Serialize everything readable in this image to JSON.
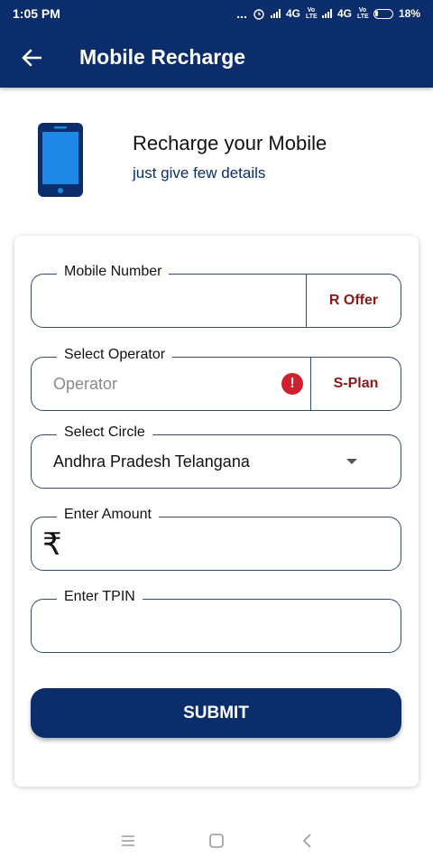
{
  "status_bar": {
    "time": "1:05 PM",
    "dots": "...",
    "network_1": "4G",
    "network_2": "4G",
    "volte_label": "Vo LTE",
    "battery": "18%"
  },
  "app_bar": {
    "title": "Mobile Recharge",
    "back_icon": "back-arrow-icon"
  },
  "header": {
    "title": "Recharge your Mobile",
    "subtitle": "just give few details",
    "icon": "mobile-phone-icon"
  },
  "form": {
    "mobile": {
      "label": "Mobile Number",
      "value": "",
      "action": "R Offer"
    },
    "operator": {
      "label": "Select Operator",
      "placeholder": "Operator",
      "action": "S-Plan",
      "error_icon": "alert-icon"
    },
    "circle": {
      "label": "Select Circle",
      "value": "Andhra Pradesh Telangana",
      "dropdown_icon": "caret-down-icon"
    },
    "amount": {
      "label": "Enter Amount",
      "currency_symbol": "₹",
      "value": ""
    },
    "tpin": {
      "label": "Enter TPIN",
      "value": ""
    },
    "submit_label": "SUBMIT"
  },
  "colors": {
    "primary": "#0b2d6b",
    "action_text": "#8b1a1a",
    "error": "#d0202f",
    "phone_blue": "#1e88e5"
  },
  "nav_bar": {
    "icons": [
      "recent-apps-icon",
      "home-icon",
      "back-icon"
    ]
  }
}
